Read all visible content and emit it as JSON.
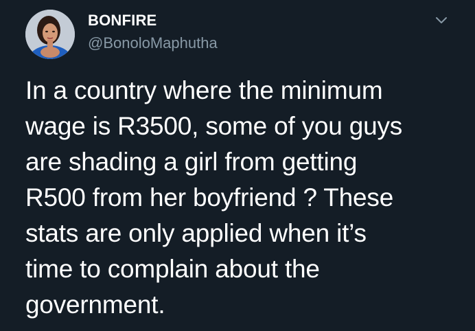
{
  "author": {
    "display_name": "BONFIRE",
    "handle": "@BonoloMaphutha",
    "avatar_icon": "profile-photo"
  },
  "menu": {
    "icon": "chevron-down-icon"
  },
  "tweet": {
    "lines": [
      "In a country where the minimum",
      "wage is R3500, some of you guys",
      "are shading a girl from getting",
      "R500 from her boyfriend ? These",
      "stats are only applied when it’s",
      "time to complain about the",
      "government."
    ]
  },
  "colors": {
    "background": "#141d26",
    "text": "#ffffff",
    "handle": "#8899a6",
    "chevron": "#8899a6"
  }
}
